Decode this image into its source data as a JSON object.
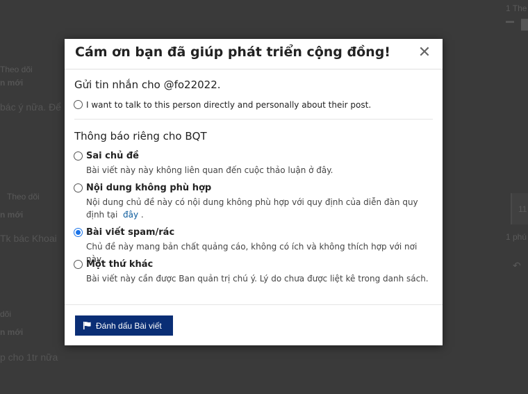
{
  "background": {
    "texts": [
      {
        "text": "Theo dõi"
      },
      {
        "text": "n mới"
      },
      {
        "text": "bác ý nữa. Để"
      },
      {
        "text": "Theo dõi"
      },
      {
        "text": "n mới"
      },
      {
        "text": "Tk bác Khoai"
      },
      {
        "text": "dõi"
      },
      {
        "text": "n mới"
      },
      {
        "text": "p cho 1tr nữa"
      },
      {
        "text": "1 The"
      },
      {
        "text": "11"
      },
      {
        "text": "1 phú"
      }
    ]
  },
  "modal": {
    "title": "Cám ơn bạn đã giúp phát triển cộng đồng!",
    "close_label": "✕",
    "message_section": {
      "title": "Gửi tin nhắn cho @fo22022.",
      "option_label": "I want to talk to this person directly and personally about their post."
    },
    "staff_section": {
      "title": "Thông báo riêng cho BQT",
      "options": [
        {
          "label": "Sai chủ đề",
          "desc": "Bài viết này này không liên quan đến cuộc thảo luận ở đây.",
          "checked": false
        },
        {
          "label": "Nội dung không phù hợp",
          "desc": "Nội dung chủ đề này có nội dung không phù hợp với quy định của diễn đàn quy định tại",
          "link": "đây",
          "desc_suffix": ".",
          "checked": false
        },
        {
          "label": "Bài viết spam/rác",
          "desc": "Chủ đề này mang bản chất quảng cáo, không có ích và không thích hợp với nơi này.",
          "checked": true
        },
        {
          "label": "Một thứ khác",
          "desc": "Bài viết này cần được Ban quản trị chú ý. Lý do chưa được liệt kê trong danh sách.",
          "checked": false
        }
      ]
    },
    "submit_label": "Đánh dấu Bài viết"
  },
  "colors": {
    "accent": "#0a2e75",
    "radio_checked": "#1a73e8",
    "link": "#0a5a9c"
  }
}
